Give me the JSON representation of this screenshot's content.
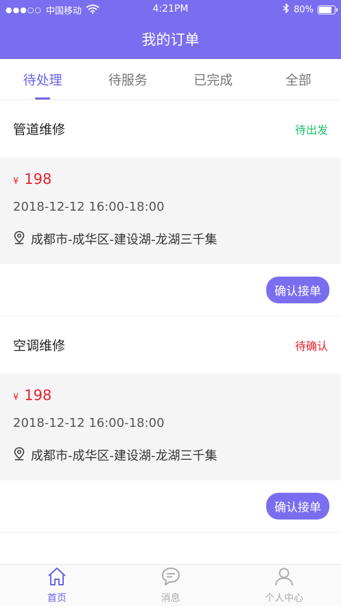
{
  "status_bar": {
    "signal_dots": "●●●○○",
    "carrier": "中国移动",
    "time": "4:21PM",
    "battery_text": "80%",
    "battery_level": 0.8,
    "icons": [
      "wifi-icon",
      "bluetooth-icon",
      "battery-icon"
    ]
  },
  "nav": {
    "title": "我的订单"
  },
  "tabs": [
    {
      "label": "待处理",
      "active": true
    },
    {
      "label": "待服务",
      "active": false
    },
    {
      "label": "已完成",
      "active": false
    },
    {
      "label": "全部",
      "active": false
    }
  ],
  "orders": [
    {
      "service": "管道维修",
      "status": "待出发",
      "status_color": "#1ec36b",
      "currency": "¥",
      "price": "198",
      "time": "2018-12-12 16:00-18:00",
      "address": "成都市-成华区-建设湖-龙湖三千集",
      "action": "确认接单"
    },
    {
      "service": "空调维修",
      "status": "待确认",
      "status_color": "#e8222f",
      "currency": "¥",
      "price": "198",
      "time": "2018-12-12 16:00-18:00",
      "address": "成都市-成华区-建设湖-龙湖三千集",
      "action": "确认接单"
    }
  ],
  "bottom_tabs": [
    {
      "label": "首页",
      "icon": "home-icon",
      "active": true
    },
    {
      "label": "消息",
      "icon": "message-icon",
      "active": false
    },
    {
      "label": "个人中心",
      "icon": "user-icon",
      "active": false
    }
  ],
  "colors": {
    "accent": "#7a6ef0",
    "price": "#e8222f"
  }
}
